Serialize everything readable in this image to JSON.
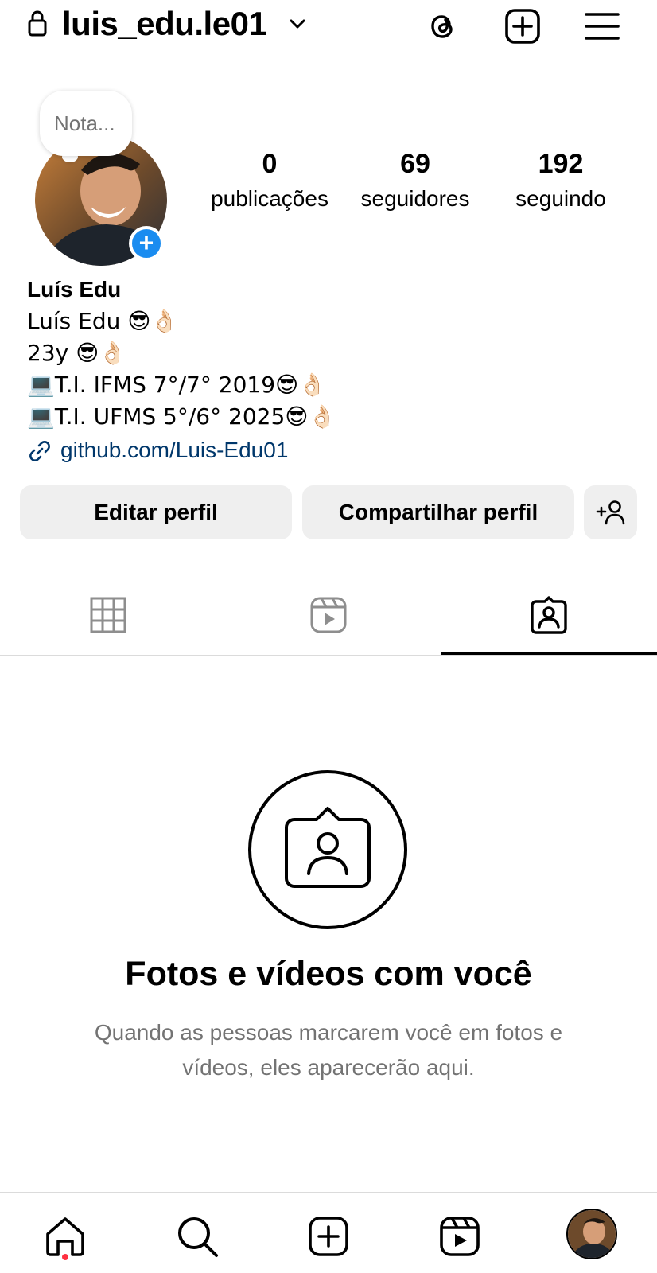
{
  "header": {
    "username": "luis_edu.le01",
    "icons": [
      "lock-icon",
      "chevron-down-icon",
      "threads-icon",
      "create-plus-icon",
      "menu-icon"
    ]
  },
  "note": {
    "placeholder": "Nota..."
  },
  "stats": [
    {
      "value": "0",
      "label": "publicações"
    },
    {
      "value": "69",
      "label": "seguidores"
    },
    {
      "value": "192",
      "label": "seguindo"
    }
  ],
  "bio": {
    "name": "Luís Edu",
    "lines": [
      "Luís Edu 😎👌🏻",
      "23y 😎👌🏻",
      "💻T.I. IFMS 7°/7° 2019😎👌🏻",
      "💻T.I. UFMS 5°/6° 2025😎👌🏻"
    ],
    "link": "github.com/Luis-Edu01"
  },
  "buttons": {
    "edit": "Editar perfil",
    "share": "Compartilhar perfil"
  },
  "tabs": [
    "grid-icon",
    "reels-icon",
    "tagged-icon"
  ],
  "active_tab": "tagged",
  "empty_state": {
    "title": "Fotos e vídeos com você",
    "subtitle": "Quando as pessoas marcarem você em fotos e vídeos, eles aparecerão aqui."
  },
  "bottom_nav": [
    "home-icon",
    "search-icon",
    "create-icon",
    "reels-icon",
    "profile-avatar"
  ],
  "colors": {
    "accent": "#1a8cf0",
    "link": "#00376b",
    "notification_dot": "#ff3040",
    "button_bg": "#efefef"
  }
}
